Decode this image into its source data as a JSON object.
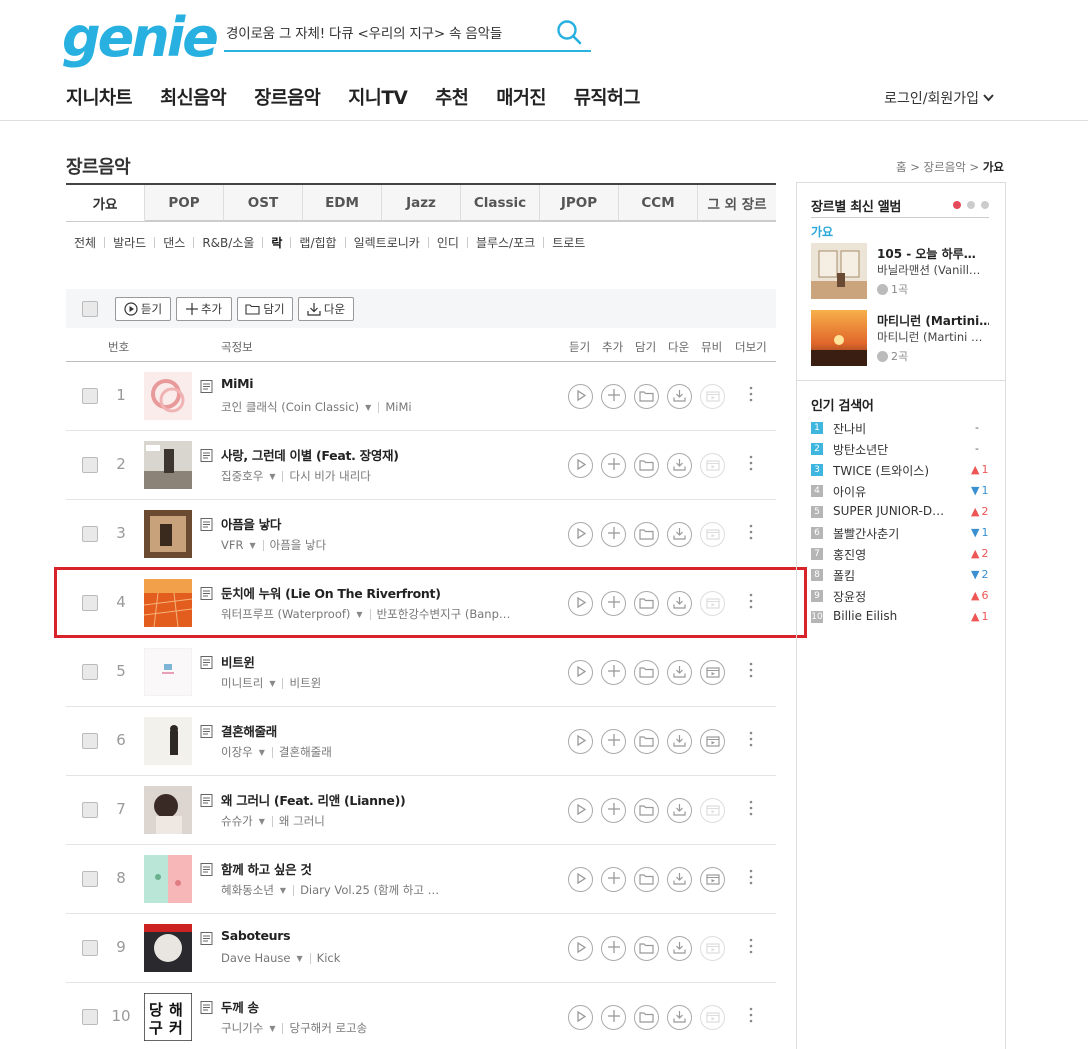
{
  "header": {
    "logo": "genie",
    "search_value": "경이로움 그 자체! 다큐 <우리의 지구> 속 음악들",
    "nav": [
      "지니차트",
      "최신음악",
      "장르음악",
      "지니TV",
      "추천",
      "매거진",
      "뮤직허그"
    ],
    "login": "로그인/회원가입"
  },
  "page": {
    "title": "장르음악",
    "breadcrumb": [
      "홈",
      "장르음악",
      "가요"
    ]
  },
  "tabs": [
    "가요",
    "POP",
    "OST",
    "EDM",
    "Jazz",
    "Classic",
    "JPOP",
    "CCM",
    "그 외 장르"
  ],
  "subgenres": [
    "전체",
    "발라드",
    "댄스",
    "R&B/소울",
    "락",
    "랩/힙합",
    "일렉트로니카",
    "인디",
    "블루스/포크",
    "트로트"
  ],
  "toolbar": {
    "play": "듣기",
    "add": "추가",
    "save": "담기",
    "download": "다운"
  },
  "list_head": {
    "no": "번호",
    "info": "곡정보",
    "play": "듣기",
    "add": "추가",
    "save": "담기",
    "down": "다운",
    "mv": "뮤비",
    "more": "더보기"
  },
  "songs": [
    {
      "no": "1",
      "title": "MiMi",
      "artist": "코인 클래식 (Coin Classic)",
      "album": "MiMi",
      "mv": false
    },
    {
      "no": "2",
      "title": "사랑, 그런데 이별 (Feat. 장영재)",
      "artist": "집중호우",
      "album": "다시 비가 내리다",
      "mv": false
    },
    {
      "no": "3",
      "title": "아픔을 낳다",
      "artist": "VFR",
      "album": "아픔을 낳다",
      "mv": false
    },
    {
      "no": "4",
      "title": "둔치에 누워 (Lie On The Riverfront)",
      "artist": "워터프루프 (Waterproof)",
      "album": "반포한강수변지구 (Banp…",
      "mv": false
    },
    {
      "no": "5",
      "title": "비트윈",
      "artist": "미니트리",
      "album": "비트윈",
      "mv": true
    },
    {
      "no": "6",
      "title": "결혼해줄래",
      "artist": "이장우",
      "album": "결혼해줄래",
      "mv": true
    },
    {
      "no": "7",
      "title": "왜 그러니 (Feat. 리앤 (Lianne))",
      "artist": "슈슈가",
      "album": "왜 그러니",
      "mv": false
    },
    {
      "no": "8",
      "title": "함께 하고 싶은 것",
      "artist": "혜화동소년",
      "album": "Diary Vol.25 (함께 하고 …",
      "mv": true
    },
    {
      "no": "9",
      "title": "Saboteurs",
      "artist": "Dave Hause",
      "album": "Kick",
      "mv": false
    },
    {
      "no": "10",
      "title": "두께 송",
      "artist": "구니기수",
      "album": "당구해커 로고송",
      "mv": false
    }
  ],
  "sidebar": {
    "latest_title": "장르별 최신 앨범",
    "genre": "가요",
    "albums": [
      {
        "title": "105 - 오늘 하루…",
        "artist": "바닐라맨션 (Vanill…",
        "count": "1곡"
      },
      {
        "title": "마티니런 (Martini…",
        "artist": "마티니런 (Martini …",
        "count": "2곡"
      }
    ],
    "popular_title": "인기 검색어",
    "popular": [
      {
        "rank": "1",
        "name": "잔나비",
        "change": "-",
        "dir": "none"
      },
      {
        "rank": "2",
        "name": "방탄소년단",
        "change": "-",
        "dir": "none"
      },
      {
        "rank": "3",
        "name": "TWICE (트와이스)",
        "change": "1",
        "dir": "up"
      },
      {
        "rank": "4",
        "name": "아이유",
        "change": "1",
        "dir": "down"
      },
      {
        "rank": "5",
        "name": "SUPER JUNIOR-D…",
        "change": "2",
        "dir": "up"
      },
      {
        "rank": "6",
        "name": "볼빨간사춘기",
        "change": "1",
        "dir": "down"
      },
      {
        "rank": "7",
        "name": "홍진영",
        "change": "2",
        "dir": "up"
      },
      {
        "rank": "8",
        "name": "폴킴",
        "change": "2",
        "dir": "down"
      },
      {
        "rank": "9",
        "name": "장윤정",
        "change": "6",
        "dir": "up"
      },
      {
        "rank": "10",
        "name": "Billie Eilish",
        "change": "1",
        "dir": "up"
      }
    ]
  },
  "colors": {
    "brand": "#28b1e0",
    "highlight": "#d9232a"
  }
}
